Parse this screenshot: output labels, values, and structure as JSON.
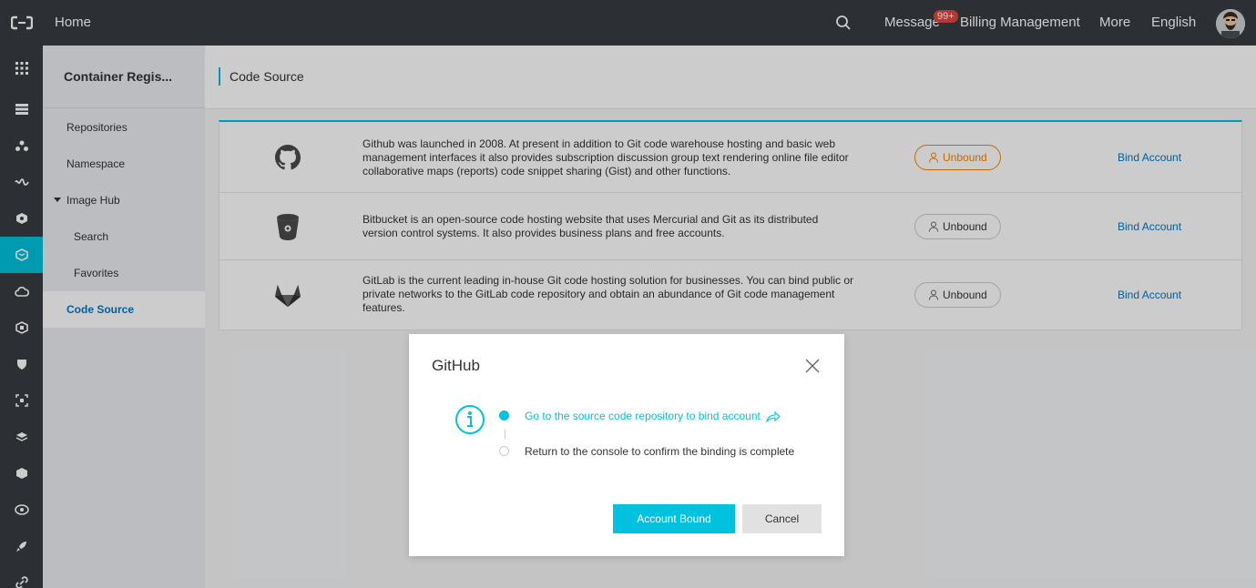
{
  "topbar": {
    "home_label": "Home",
    "message_label": "Message",
    "message_badge": "99+",
    "billing_label": "Billing Management",
    "more_label": "More",
    "language_label": "English"
  },
  "sidebar": {
    "title": "Container Regis...",
    "items": [
      {
        "label": "Repositories"
      },
      {
        "label": "Namespace"
      },
      {
        "label": "Image Hub"
      },
      {
        "label": "Search"
      },
      {
        "label": "Favorites"
      },
      {
        "label": "Code Source"
      }
    ]
  },
  "page": {
    "title": "Code Source"
  },
  "sources": [
    {
      "icon": "github-icon",
      "description": "Github was launched in 2008. At present in addition to Git code warehouse hosting and basic web management interfaces it also provides subscription discussion group text rendering online file editor collaborative maps (reports) code snippet sharing (Gist) and other functions.",
      "status": "Unbound",
      "action": "Bind Account"
    },
    {
      "icon": "bitbucket-icon",
      "description": "Bitbucket is an open-source code hosting website that uses Mercurial and Git as its distributed version control systems. It also provides business plans and free accounts.",
      "status": "Unbound",
      "action": "Bind Account"
    },
    {
      "icon": "gitlab-icon",
      "description": "GitLab is the current leading in-house Git code hosting solution for businesses. You can bind public or private networks to the GitLab code repository and obtain an abundance of Git code management features.",
      "status": "Unbound",
      "action": "Bind Account"
    }
  ],
  "dialog": {
    "title": "GitHub",
    "step1": "Go to the source code repository to bind account",
    "step2": "Return to the console to confirm the binding is complete",
    "confirm_label": "Account Bound",
    "cancel_label": "Cancel"
  },
  "colors": {
    "accent": "#00c1de",
    "link": "#0079c2",
    "warning": "#f68300",
    "topbar": "#373d41"
  }
}
